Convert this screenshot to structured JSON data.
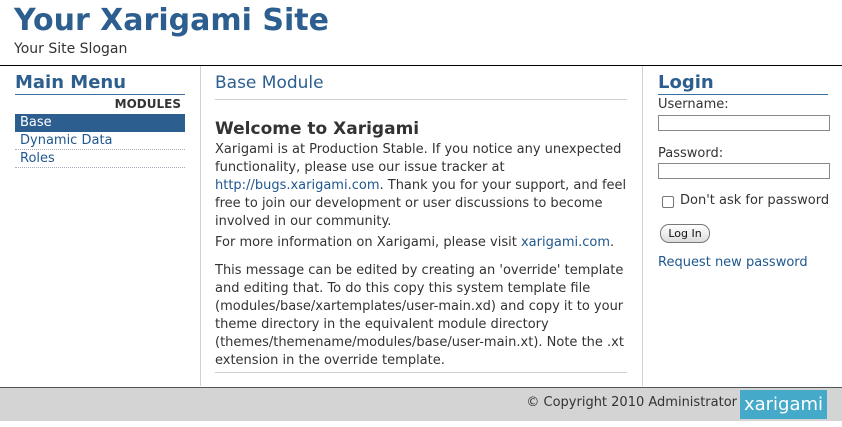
{
  "header": {
    "site_title": "Your Xarigami Site",
    "site_slogan": "Your Site Slogan"
  },
  "main_menu": {
    "title": "Main Menu",
    "section_label": "MODULES",
    "items": [
      {
        "label": "Base",
        "active": true
      },
      {
        "label": "Dynamic Data",
        "active": false
      },
      {
        "label": "Roles",
        "active": false
      }
    ]
  },
  "content": {
    "module_title": "Base Module",
    "welcome_heading": "Welcome to Xarigami",
    "p1_before": "Xarigami is at Production Stable. If you notice any unexpected functionality, please use our issue tracker at ",
    "p1_link": "http://bugs.xarigami.com",
    "p1_after": ". Thank you for your support, and feel free to join our development or user discussions to become involved in our community.",
    "p2_before": "For more information on Xarigami, please visit ",
    "p2_link": "xarigami.com",
    "p2_after": ".",
    "p3": "This message can be edited by creating an 'override' template and editing that. To do this copy this system template file (modules/base/xartemplates/user-main.xd) and copy it to your theme directory in the equivalent module directory (themes/themename/modules/base/user-main.xt). Note the .xt extension in the override template."
  },
  "login": {
    "title": "Login",
    "username_label": "Username:",
    "username_value": "",
    "password_label": "Password:",
    "password_value": "",
    "remember_label": "Don't ask for password",
    "remember_checked": false,
    "button_label": "Log In",
    "request_link": "Request new password"
  },
  "footer": {
    "copyright": "© Copyright 2010 Administrator",
    "logo_text": "xarigami"
  },
  "colors": {
    "accent": "#2c5f8f",
    "link": "#21588f",
    "footer_bg": "#d4d4d4",
    "logo_bg": "#45a9c9"
  }
}
